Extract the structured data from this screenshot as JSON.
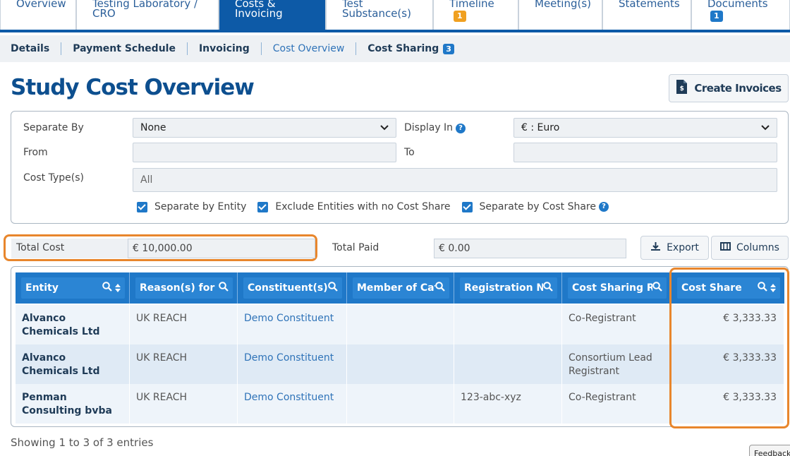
{
  "top_tabs": [
    {
      "label": "Overview",
      "badge": ""
    },
    {
      "label": "Testing Laboratory /\nCRO",
      "badge": ""
    },
    {
      "label": "Costs &\nInvoicing",
      "badge": ""
    },
    {
      "label": "Test\nSubstance(s)",
      "badge": ""
    },
    {
      "label": "Timeline",
      "badge": "1"
    },
    {
      "label": "Meeting(s)",
      "badge": ""
    },
    {
      "label": "Statements",
      "badge": ""
    },
    {
      "label": "Documents",
      "badge": "1"
    }
  ],
  "sub_nav": [
    {
      "label": "Details"
    },
    {
      "label": "Payment Schedule"
    },
    {
      "label": "Invoicing"
    },
    {
      "label": "Cost Overview"
    },
    {
      "label": "Cost Sharing",
      "badge": "3"
    }
  ],
  "title": "Study Cost Overview",
  "create_invoices_label": "Create Invoices",
  "filters": {
    "separate_by_label": "Separate By",
    "separate_by_value": "None",
    "display_in_label": "Display In",
    "display_in_value": "€ : Euro",
    "from_label": "From",
    "to_label": "To",
    "cost_types_label": "Cost Type(s)",
    "cost_types_placeholder": "All",
    "checks": [
      {
        "label": "Separate by Entity"
      },
      {
        "label": "Exclude Entities with no Cost Share"
      },
      {
        "label": "Separate by Cost Share"
      }
    ]
  },
  "totals": {
    "total_cost_label": "Total Cost",
    "total_cost_value": "€ 10,000.00",
    "total_paid_label": "Total Paid",
    "total_paid_value": "€ 0.00"
  },
  "export_label": "Export",
  "columns_label": "Columns",
  "table": {
    "headers": [
      "Entity",
      "Reason(s) for I",
      "Constituent(s)",
      "Member of Cat",
      "Registration N",
      "Cost Sharing Ro",
      "Cost Share"
    ],
    "rows": [
      {
        "entity": "Alvanco Chemicals Ltd",
        "reason": "UK REACH",
        "constituent": "Demo Constituent",
        "member": "",
        "registration": "",
        "role": "Co-Registrant",
        "share": "€ 3,333.33"
      },
      {
        "entity": "Alvanco Chemicals Ltd",
        "reason": "UK REACH",
        "constituent": "Demo Constituent",
        "member": "",
        "registration": "",
        "role": "Consortium Lead Registrant",
        "share": "€ 3,333.33"
      },
      {
        "entity": "Penman Consulting bvba",
        "reason": "UK REACH",
        "constituent": "Demo Constituent",
        "member": "",
        "registration": "123-abc-xyz",
        "role": "Co-Registrant",
        "share": "€ 3,333.33"
      }
    ]
  },
  "info_text": "Showing 1 to 3 of 3 entries",
  "feedback_label": "Feedback"
}
